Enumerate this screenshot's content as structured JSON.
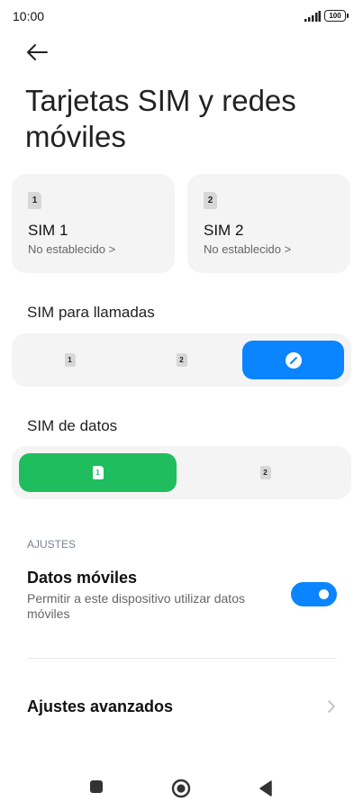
{
  "status_bar": {
    "time": "10:00",
    "battery": "100"
  },
  "header": {
    "back_icon": "arrow-left-icon",
    "title": "Tarjetas SIM y redes móviles"
  },
  "sim_cards": [
    {
      "chip": "1",
      "name": "SIM 1",
      "status": "No establecido >"
    },
    {
      "chip": "2",
      "name": "SIM 2",
      "status": "No establecido >"
    }
  ],
  "calls": {
    "label": "SIM para llamadas",
    "options": [
      "1",
      "2",
      "auto"
    ],
    "selected": "auto",
    "active_color": "#0a84ff"
  },
  "data_sim": {
    "label": "SIM de datos",
    "options": [
      "1",
      "2"
    ],
    "selected": "1",
    "active_color": "#1fbd5e"
  },
  "settings": {
    "header": "AJUSTES",
    "mobile_data": {
      "title": "Datos móviles",
      "description": "Permitir a este dispositivo utilizar datos móviles",
      "enabled": true
    }
  },
  "advanced": {
    "label": "Ajustes avanzados"
  },
  "nav_bar": {
    "icons": [
      "square-recents-icon",
      "circle-home-icon",
      "triangle-back-icon"
    ]
  }
}
